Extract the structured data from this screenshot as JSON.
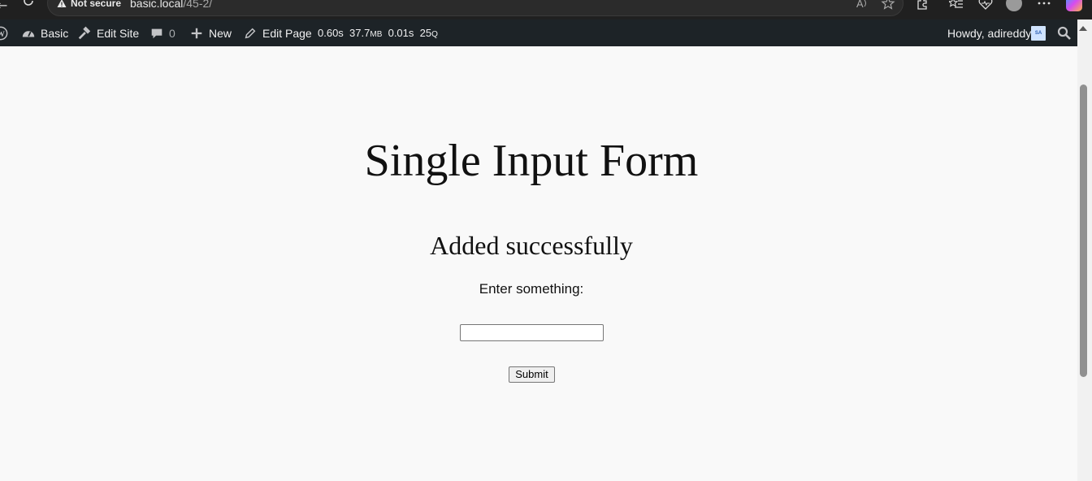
{
  "browser": {
    "security_label": "Not secure",
    "url_host": "basic.local",
    "url_path": "/45-2/"
  },
  "adminbar": {
    "site_name": "Basic",
    "edit_site": "Edit Site",
    "comments_count": "0",
    "new_label": "New",
    "edit_page": "Edit Page",
    "stats": {
      "time": "0.60s",
      "memory_value": "37.7",
      "memory_unit": "MB",
      "query_time": "0.01s",
      "queries_value": "25",
      "queries_unit": "Q"
    },
    "howdy": "Howdy, adireddy",
    "avatar_initials": "SA"
  },
  "page": {
    "title": "Single Input Form",
    "status_message": "Added successfully",
    "field_label": "Enter something:",
    "input_value": "",
    "submit_label": "Submit"
  }
}
